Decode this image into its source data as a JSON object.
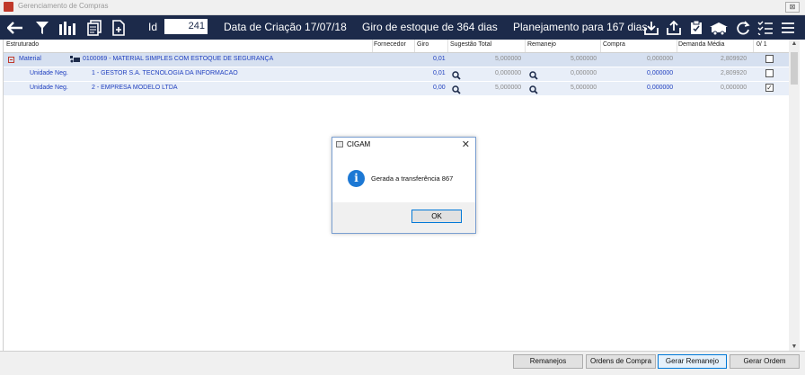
{
  "window": {
    "title": "Gerenciamento de Compras",
    "close_label": "⊠"
  },
  "toolbar": {
    "id_label": "Id",
    "id_value": "241",
    "creation_date": "Data de Criação 17/07/18",
    "stock_turnover": "Giro de estoque de  364 dias",
    "planning": "Planejamento para 167 dias"
  },
  "grid": {
    "headers": [
      "Estruturado",
      "Fornecedor",
      "Giro",
      "Sugestão Total",
      "Remanejo",
      "Compra",
      "Demanda Média",
      "0/ 1"
    ],
    "rows": [
      {
        "type": "Material",
        "description": "0100069 - MATERIAL SIMPLES COM ESTOQUE DE SEGURANÇA",
        "giro": "0,01",
        "sugestao": "5,000000",
        "remanejo": "5,000000",
        "compra": "0,000000",
        "demanda": "2,809920",
        "checked": false
      },
      {
        "type": "Unidade Neg.",
        "description": "1 - GESTOR S.A. TECNOLOGIA DA INFORMACAO",
        "giro": "0,01",
        "sugestao": "0,000000",
        "remanejo": "0,000000",
        "compra": "0,000000",
        "demanda": "2,809920",
        "checked": false
      },
      {
        "type": "Unidade Neg.",
        "description": "2 - EMPRESA MODELO LTDA",
        "giro": "0,00",
        "sugestao": "5,000000",
        "remanejo": "5,000000",
        "compra": "0,000000",
        "demanda": "0,000000",
        "checked": true
      }
    ]
  },
  "buttons": {
    "remanejos": "Remanejos",
    "ordens_compra": "Ordens de Compra",
    "gerar_remanejo": "Gerar Remanejo",
    "gerar_ordem": "Gerar Ordem"
  },
  "dialog": {
    "title": "CIGAM",
    "close": "✕",
    "message": "Gerada a transferência 867",
    "ok_label": "OK",
    "info_glyph": "i"
  },
  "colors": {
    "toolbar_bg": "#1c2a4a",
    "accent_blue": "#1f3fbf",
    "row_highlight": "#dfe8f5"
  }
}
